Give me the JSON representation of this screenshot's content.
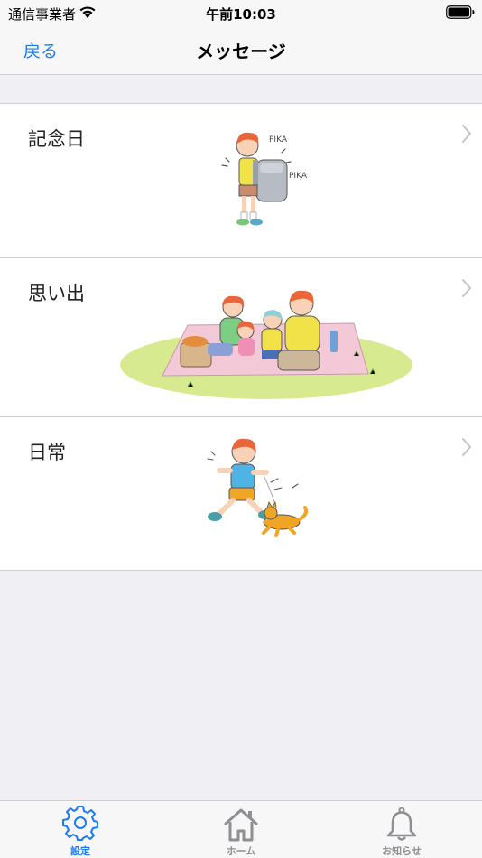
{
  "status_bar": {
    "carrier": "通信事業者",
    "time": "午前10:03",
    "icons": [
      "wifi-icon",
      "battery-icon"
    ]
  },
  "nav": {
    "back_label": "戻る",
    "title": "メッセージ"
  },
  "list": {
    "items": [
      {
        "label": "記念日",
        "illustration": "child-with-school-backpack"
      },
      {
        "label": "思い出",
        "illustration": "family-picnic"
      },
      {
        "label": "日常",
        "illustration": "child-running-with-cat"
      }
    ]
  },
  "tab_bar": {
    "tabs": [
      {
        "label": "設定",
        "icon": "gear-icon",
        "selected": true
      },
      {
        "label": "ホーム",
        "icon": "home-icon",
        "selected": false
      },
      {
        "label": "お知らせ",
        "icon": "bell-icon",
        "selected": false
      }
    ]
  },
  "colors": {
    "accent": "#1a7cf2",
    "background": "#efeff4",
    "bar": "#f7f7f7",
    "inactive_tab": "#8e8e93"
  }
}
